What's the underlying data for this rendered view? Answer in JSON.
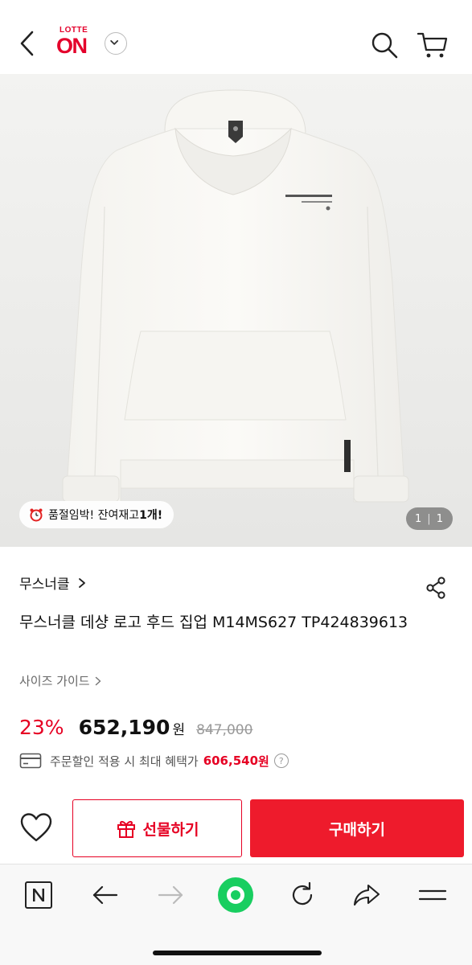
{
  "header": {
    "logo_top": "LOTTE",
    "logo_main": "ON",
    "icons": [
      "back-arrow-icon",
      "chevron-down-icon",
      "search-icon",
      "cart-icon"
    ]
  },
  "gallery": {
    "stock_badge": {
      "prefix": "품절임박! 잔여재고 ",
      "count": "1개!"
    },
    "page_current": "1",
    "page_total": "1"
  },
  "product": {
    "brand": "무스너클",
    "title": "무스너클 데샹 로고 후드 집업 M14MS627 TP424839613",
    "size_guide": "사이즈 가이드",
    "discount": "23%",
    "price": "652,190",
    "price_unit": "원",
    "original_price": "847,000",
    "benefit_text": "주문할인 적용 시 최대 혜택가",
    "benefit_price": "606,540",
    "benefit_unit": "원",
    "help_icon": "?"
  },
  "actions": {
    "gift": "선물하기",
    "buy": "구매하기"
  },
  "colors": {
    "accent": "#e60023",
    "buy_button": "#ee1b2c",
    "logo": "#e4002b"
  }
}
